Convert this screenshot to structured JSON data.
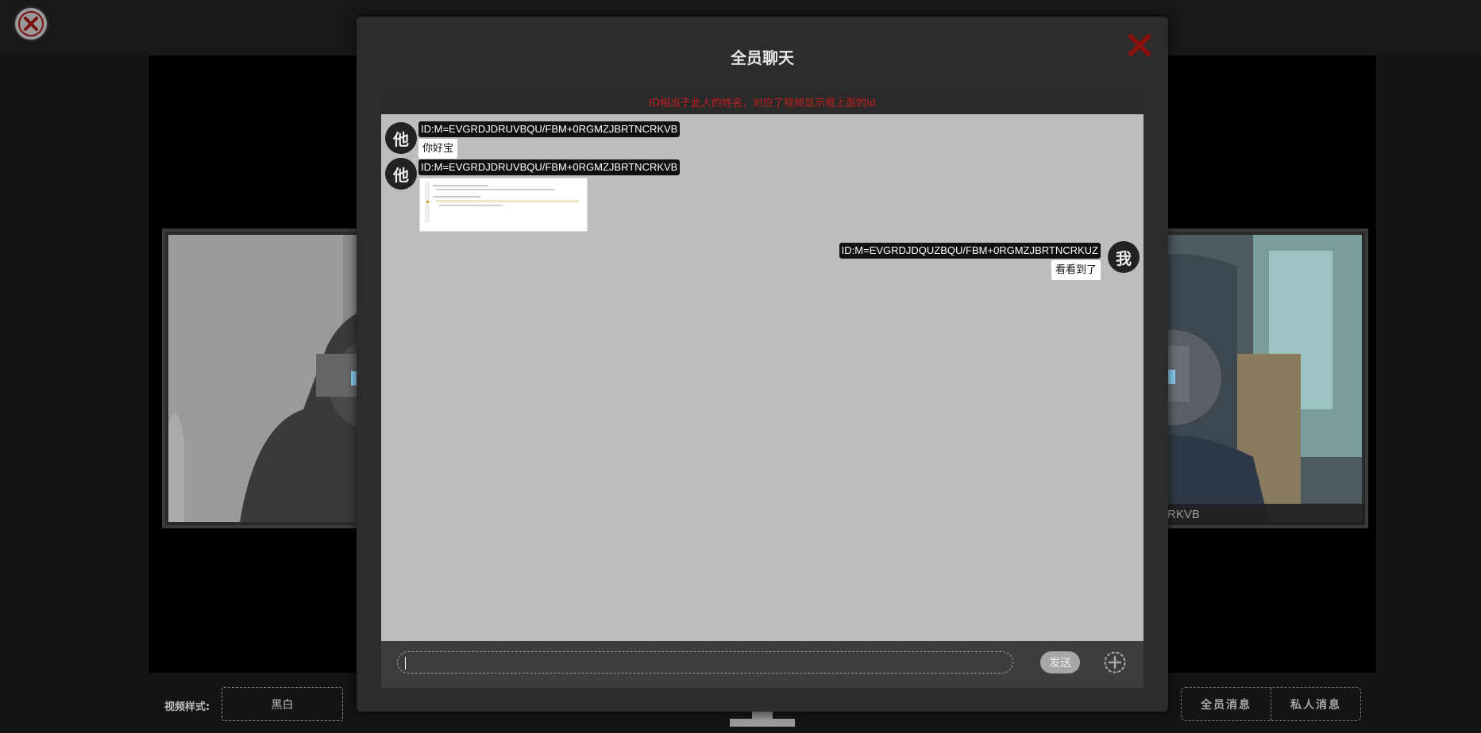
{
  "page": {
    "bottom": {
      "style_label": "视频样式:",
      "style_value": "黑白",
      "tabs": [
        "全员消息",
        "私人消息"
      ]
    },
    "videos": {
      "right_id": "ZJBRTNCRKVB"
    }
  },
  "chat": {
    "title": "全员聊天",
    "notice": "ID相当于此人的姓名，对应了视频显示框上面的id",
    "messages": [
      {
        "side": "left",
        "avatar": "他",
        "id": "ID:M=EVGRDJDRUVBQU/FBM+0RGMZJBRTNCRKVB",
        "type": "text",
        "text": "你好宝"
      },
      {
        "side": "left",
        "avatar": "他",
        "id": "ID:M=EVGRDJDRUVBQU/FBM+0RGMZJBRTNCRKVB",
        "type": "image"
      },
      {
        "side": "right",
        "avatar": "我",
        "id": "ID:M=EVGRDJDQUZBQU/FBM+0RGMZJBRTNCRKUZ",
        "type": "text",
        "text": "看看到了"
      }
    ],
    "input": {
      "value": "",
      "placeholder": ""
    },
    "send_label": "发送"
  },
  "icons": {
    "exit": "close-circle-icon",
    "modal_close": "close-x-icon",
    "add": "plus-circle-icon",
    "stand": "monitor-stand-icon"
  },
  "colors": {
    "notice": "#c41d1d",
    "close_red": "#8b1111",
    "chat_bg": "#bdbdbd",
    "modal_bg": "#2c2c2c"
  }
}
